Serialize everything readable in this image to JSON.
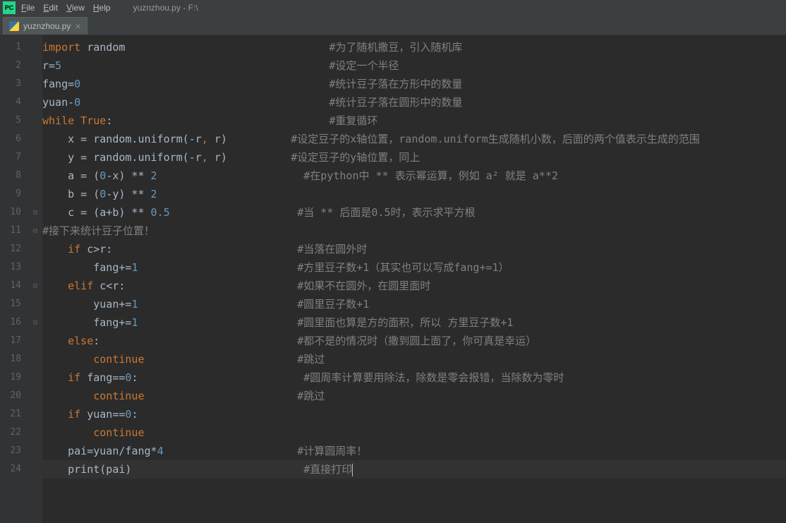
{
  "menubar": {
    "items": [
      {
        "prefix": "F",
        "rest": "ile"
      },
      {
        "prefix": "E",
        "rest": "dit"
      },
      {
        "prefix": "V",
        "rest": "iew"
      },
      {
        "prefix": "H",
        "rest": "elp"
      }
    ],
    "path": "yuznzhou.py - F:\\"
  },
  "tab": {
    "label": "yuznzhou.py",
    "close": "×"
  },
  "lines": [
    {
      "n": "1",
      "seg": [
        {
          "c": "kw",
          "t": "import"
        },
        {
          "c": "txt",
          "t": " random                                "
        },
        {
          "c": "cmt",
          "t": "#为了随机撒豆，引入随机库"
        }
      ]
    },
    {
      "n": "2",
      "seg": [
        {
          "c": "txt",
          "t": "r="
        },
        {
          "c": "num",
          "t": "5"
        },
        {
          "c": "txt",
          "t": "                                          "
        },
        {
          "c": "cmt",
          "t": "#设定一个半径"
        }
      ]
    },
    {
      "n": "3",
      "seg": [
        {
          "c": "txt",
          "t": "fang="
        },
        {
          "c": "num",
          "t": "0"
        },
        {
          "c": "txt",
          "t": "                                       "
        },
        {
          "c": "cmt",
          "t": "#统计豆子落在方形中的数量"
        }
      ]
    },
    {
      "n": "4",
      "seg": [
        {
          "c": "txt",
          "t": "yuan-"
        },
        {
          "c": "num",
          "t": "0"
        },
        {
          "c": "txt",
          "t": "                                       "
        },
        {
          "c": "cmt",
          "t": "#统计豆子落在圆形中的数量"
        }
      ]
    },
    {
      "n": "5",
      "seg": [
        {
          "c": "kw",
          "t": "while True"
        },
        {
          "c": "txt",
          "t": ":                                  "
        },
        {
          "c": "cmt",
          "t": "#重复循环"
        }
      ]
    },
    {
      "n": "6",
      "seg": [
        {
          "c": "txt",
          "t": "    x = random.uniform(-r"
        },
        {
          "c": "cc",
          "t": ","
        },
        {
          "c": "txt",
          "t": " r)          "
        },
        {
          "c": "cmt",
          "t": "#设定豆子的x轴位置，random.uniform生成随机小数，后面的两个值表示生成的范围"
        }
      ]
    },
    {
      "n": "7",
      "seg": [
        {
          "c": "txt",
          "t": "    y = random.uniform(-r"
        },
        {
          "c": "cc",
          "t": ","
        },
        {
          "c": "txt",
          "t": " r)          "
        },
        {
          "c": "cmt",
          "t": "#设定豆子的y轴位置，同上"
        }
      ]
    },
    {
      "n": "8",
      "seg": [
        {
          "c": "txt",
          "t": "    a = ("
        },
        {
          "c": "num",
          "t": "0"
        },
        {
          "c": "txt",
          "t": "-x) ** "
        },
        {
          "c": "num",
          "t": "2"
        },
        {
          "c": "txt",
          "t": "                       "
        },
        {
          "c": "cmt",
          "t": "#在python中 ** 表示幂运算，例如 a² 就是 a**2"
        }
      ]
    },
    {
      "n": "9",
      "seg": [
        {
          "c": "txt",
          "t": "    b = ("
        },
        {
          "c": "num",
          "t": "0"
        },
        {
          "c": "txt",
          "t": "-y) ** "
        },
        {
          "c": "num",
          "t": "2"
        }
      ]
    },
    {
      "n": "10",
      "seg": [
        {
          "c": "txt",
          "t": "    c = (a+b) ** "
        },
        {
          "c": "num",
          "t": "0.5"
        },
        {
          "c": "txt",
          "t": "                    "
        },
        {
          "c": "cmt",
          "t": "#当 ** 后面是0.5时，表示求平方根"
        }
      ],
      "fold": "⊟"
    },
    {
      "n": "11",
      "seg": [
        {
          "c": "cmt",
          "t": "#接下来统计豆子位置！"
        }
      ],
      "fold": "⊟"
    },
    {
      "n": "12",
      "seg": [
        {
          "c": "txt",
          "t": "    "
        },
        {
          "c": "kw",
          "t": "if"
        },
        {
          "c": "txt",
          "t": " c>r:                             "
        },
        {
          "c": "cmt",
          "t": "#当落在圆外时"
        }
      ]
    },
    {
      "n": "13",
      "seg": [
        {
          "c": "txt",
          "t": "        fang+="
        },
        {
          "c": "num",
          "t": "1"
        },
        {
          "c": "txt",
          "t": "                         "
        },
        {
          "c": "cmt",
          "t": "#方里豆子数+1（其实也可以写成fang+=1）"
        }
      ]
    },
    {
      "n": "14",
      "seg": [
        {
          "c": "txt",
          "t": "    "
        },
        {
          "c": "kw",
          "t": "elif"
        },
        {
          "c": "txt",
          "t": " c<r:                           "
        },
        {
          "c": "cmt",
          "t": "#如果不在圆外，在圆里面时"
        }
      ],
      "fold": "⊟"
    },
    {
      "n": "15",
      "seg": [
        {
          "c": "txt",
          "t": "        yuan+="
        },
        {
          "c": "num",
          "t": "1"
        },
        {
          "c": "txt",
          "t": "                         "
        },
        {
          "c": "cmt",
          "t": "#圆里豆子数+1"
        }
      ]
    },
    {
      "n": "16",
      "seg": [
        {
          "c": "txt",
          "t": "        fang+="
        },
        {
          "c": "num",
          "t": "1"
        },
        {
          "c": "txt",
          "t": "                         "
        },
        {
          "c": "cmt",
          "t": "#圆里面也算是方的面积，所以 方里豆子数+1"
        }
      ],
      "fold": "⊡"
    },
    {
      "n": "17",
      "seg": [
        {
          "c": "txt",
          "t": "    "
        },
        {
          "c": "kw",
          "t": "else"
        },
        {
          "c": "txt",
          "t": ":                               "
        },
        {
          "c": "cmt",
          "t": "#都不是的情况时（撒到圆上面了，你可真是幸运）"
        }
      ]
    },
    {
      "n": "18",
      "seg": [
        {
          "c": "txt",
          "t": "        "
        },
        {
          "c": "kw",
          "t": "continue"
        },
        {
          "c": "txt",
          "t": "                        "
        },
        {
          "c": "cmt",
          "t": "#跳过"
        }
      ]
    },
    {
      "n": "19",
      "seg": [
        {
          "c": "txt",
          "t": "    "
        },
        {
          "c": "kw",
          "t": "if"
        },
        {
          "c": "txt",
          "t": " fang=="
        },
        {
          "c": "num",
          "t": "0"
        },
        {
          "c": "txt",
          "t": ":                          "
        },
        {
          "c": "cmt",
          "t": "#圆周率计算要用除法，除数是零会报错，当除数为零时"
        }
      ]
    },
    {
      "n": "20",
      "seg": [
        {
          "c": "txt",
          "t": "        "
        },
        {
          "c": "kw",
          "t": "continue"
        },
        {
          "c": "txt",
          "t": "                        "
        },
        {
          "c": "cmt",
          "t": "#跳过"
        }
      ]
    },
    {
      "n": "21",
      "seg": [
        {
          "c": "txt",
          "t": "    "
        },
        {
          "c": "kw",
          "t": "if"
        },
        {
          "c": "txt",
          "t": " yuan=="
        },
        {
          "c": "num",
          "t": "0"
        },
        {
          "c": "txt",
          "t": ":"
        }
      ]
    },
    {
      "n": "22",
      "seg": [
        {
          "c": "txt",
          "t": "        "
        },
        {
          "c": "kw",
          "t": "continue"
        }
      ]
    },
    {
      "n": "23",
      "seg": [
        {
          "c": "txt",
          "t": "    pai=yuan/fang*"
        },
        {
          "c": "num",
          "t": "4"
        },
        {
          "c": "txt",
          "t": "                     "
        },
        {
          "c": "cmt",
          "t": "#计算圆周率！"
        }
      ]
    },
    {
      "n": "24",
      "seg": [
        {
          "c": "txt",
          "t": "    print(pai)                           "
        },
        {
          "c": "cmt",
          "t": "#直接打印"
        }
      ],
      "cur": true
    }
  ]
}
